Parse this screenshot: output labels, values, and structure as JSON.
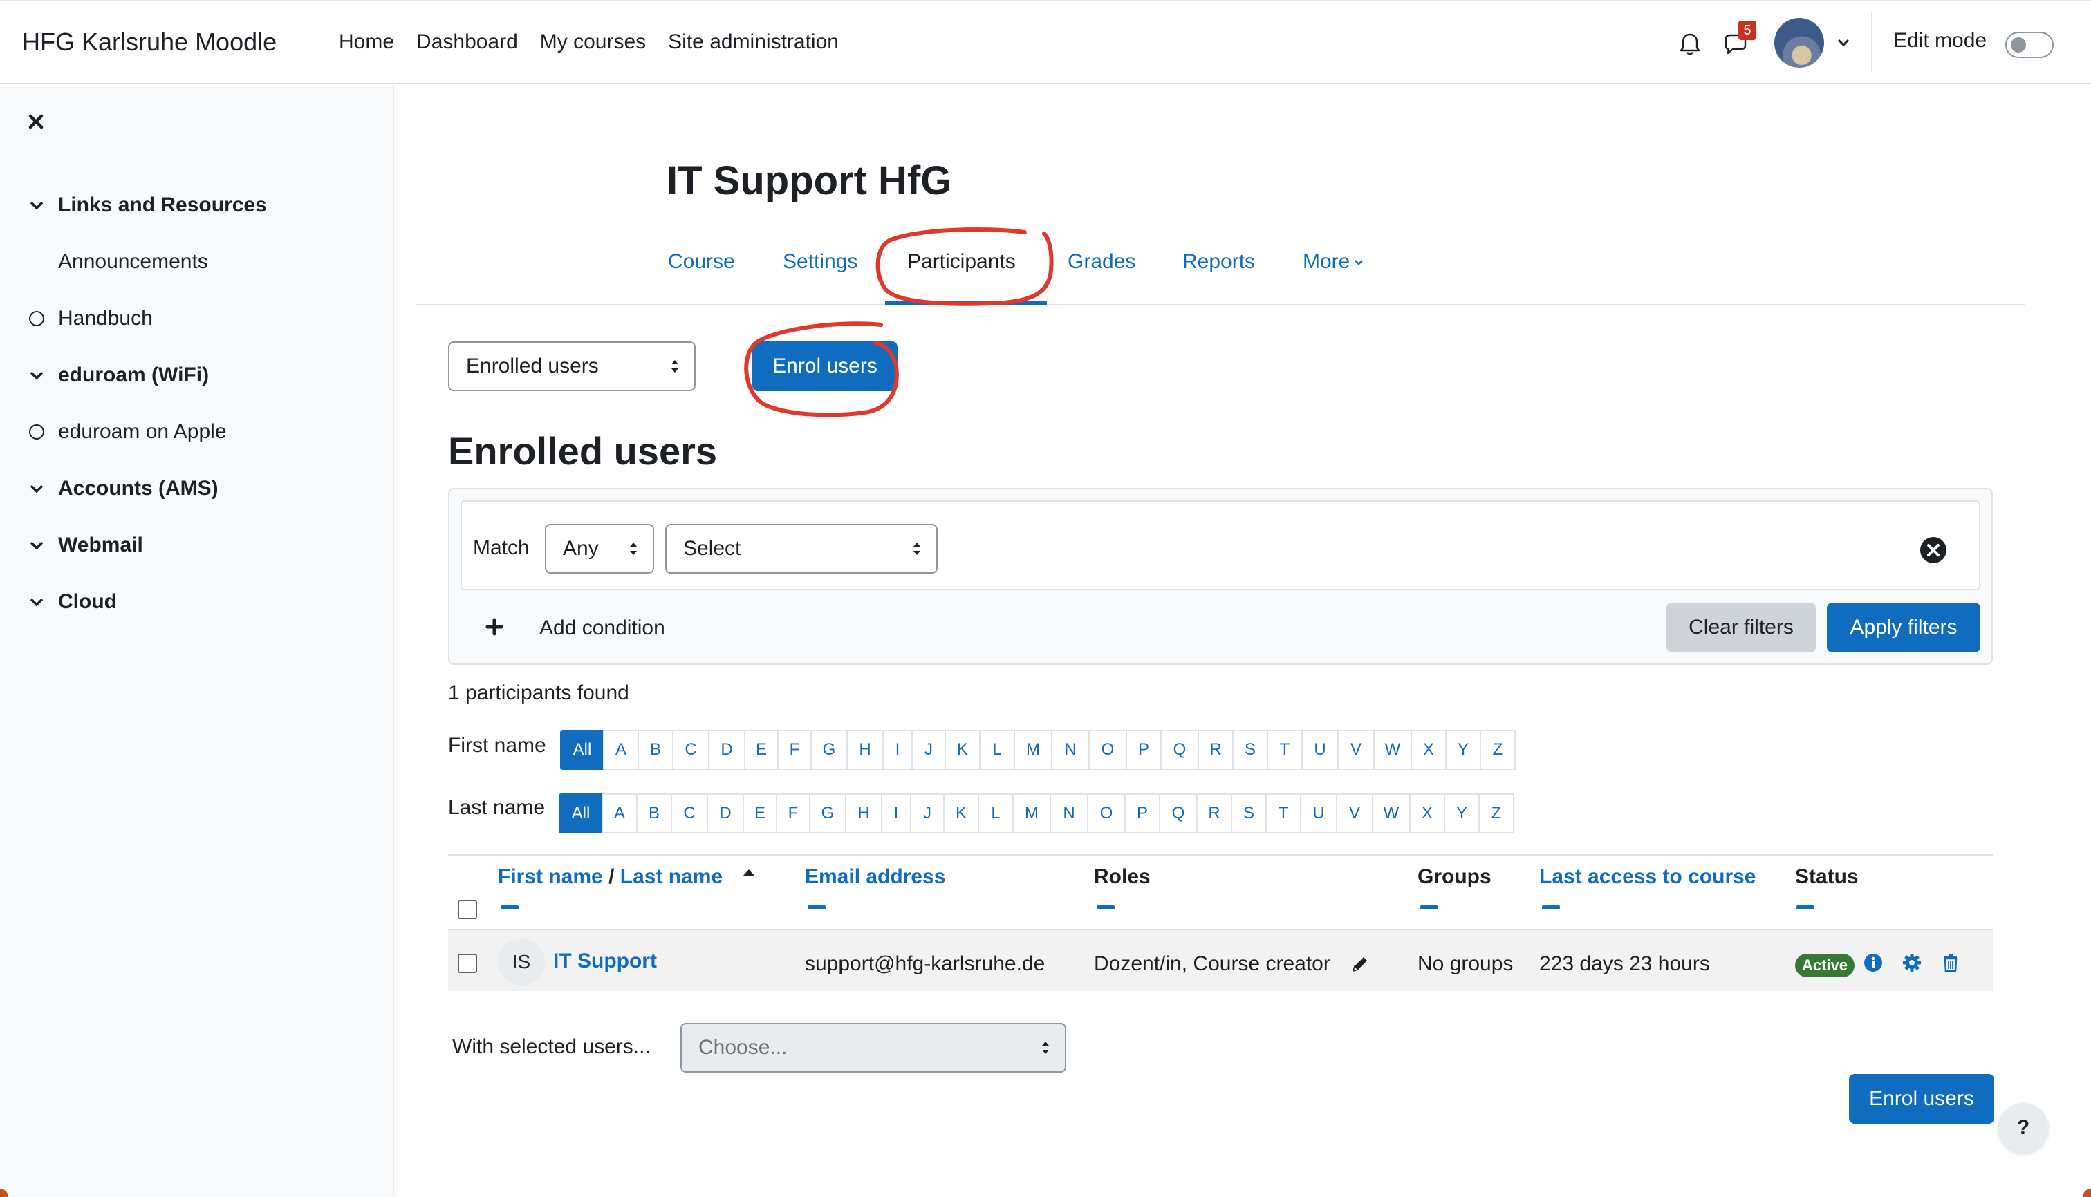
{
  "navbar": {
    "brand": "HFG Karlsruhe Moodle",
    "links": [
      "Home",
      "Dashboard",
      "My courses",
      "Site administration"
    ],
    "message_badge": "5",
    "edit_mode_label": "Edit mode",
    "edit_mode_on": false
  },
  "sidebar": {
    "items": [
      {
        "label": "Links and Resources",
        "kind": "section"
      },
      {
        "label": "Announcements",
        "kind": "activity"
      },
      {
        "label": "Handbuch",
        "kind": "page"
      },
      {
        "label": "eduroam (WiFi)",
        "kind": "section"
      },
      {
        "label": "eduroam on Apple",
        "kind": "page"
      },
      {
        "label": "Accounts (AMS)",
        "kind": "section"
      },
      {
        "label": "Webmail",
        "kind": "section"
      },
      {
        "label": "Cloud",
        "kind": "section"
      }
    ]
  },
  "course": {
    "title": "IT Support HfG",
    "tabs": [
      "Course",
      "Settings",
      "Participants",
      "Grades",
      "Reports",
      "More"
    ],
    "active_tab": "Participants"
  },
  "participants": {
    "view_select": "Enrolled users",
    "enrol_button": "Enrol users",
    "heading": "Enrolled users",
    "filter": {
      "match_label": "Match",
      "match_value": "Any",
      "condition_select": "Select",
      "add_condition": "Add condition",
      "clear_filters": "Clear filters",
      "apply_filters": "Apply filters"
    },
    "found_text": "1 participants found",
    "first_name_label": "First name",
    "last_name_label": "Last name",
    "initials": [
      "All",
      "A",
      "B",
      "C",
      "D",
      "E",
      "F",
      "G",
      "H",
      "I",
      "J",
      "K",
      "L",
      "M",
      "N",
      "O",
      "P",
      "Q",
      "R",
      "S",
      "T",
      "U",
      "V",
      "W",
      "X",
      "Y",
      "Z"
    ],
    "table": {
      "headers": {
        "first_name": "First name",
        "separator": "/",
        "last_name": "Last name",
        "email": "Email address",
        "roles": "Roles",
        "groups": "Groups",
        "last_access": "Last access to course",
        "status": "Status"
      },
      "rows": [
        {
          "initials": "IS",
          "name": "IT Support",
          "email": "support@hfg-karlsruhe.de",
          "roles": "Dozent/in, Course creator",
          "groups": "No groups",
          "last_access": "223 days 23 hours",
          "status": "Active"
        }
      ]
    },
    "with_selected_label": "With selected users...",
    "with_selected_placeholder": "Choose...",
    "enrol_button_bottom": "Enrol users"
  },
  "help_button": "?",
  "colors": {
    "primary": "#0f6cbf",
    "annotation_red": "#e2382b",
    "active_badge": "#357a32",
    "message_badge": "#ca3120"
  }
}
